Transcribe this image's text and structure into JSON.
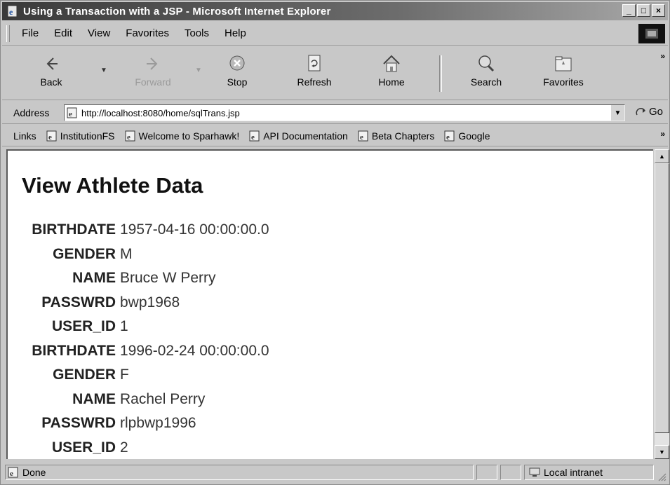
{
  "window": {
    "title": "Using a Transaction with a JSP - Microsoft Internet Explorer",
    "minimize": "_",
    "maximize": "□",
    "close": "×"
  },
  "menu": [
    "File",
    "Edit",
    "View",
    "Favorites",
    "Tools",
    "Help"
  ],
  "toolbar": {
    "back": "Back",
    "forward": "Forward",
    "stop": "Stop",
    "refresh": "Refresh",
    "home": "Home",
    "search": "Search",
    "favorites": "Favorites",
    "more": "»"
  },
  "address": {
    "label": "Address",
    "url": "http://localhost:8080/home/sqlTrans.jsp",
    "go": "Go"
  },
  "links": {
    "label": "Links",
    "items": [
      "InstitutionFS",
      "Welcome to Sparhawk!",
      "API Documentation",
      "Beta Chapters",
      "Google"
    ],
    "more": "»"
  },
  "page": {
    "heading": "View Athlete Data",
    "rows": [
      {
        "name": "BIRTHDATE",
        "value": "1957-04-16 00:00:00.0"
      },
      {
        "name": "GENDER",
        "value": "M"
      },
      {
        "name": "NAME",
        "value": "Bruce W Perry"
      },
      {
        "name": "PASSWRD",
        "value": "bwp1968"
      },
      {
        "name": "USER_ID",
        "value": "1"
      },
      {
        "name": "BIRTHDATE",
        "value": "1996-02-24 00:00:00.0"
      },
      {
        "name": "GENDER",
        "value": "F"
      },
      {
        "name": "NAME",
        "value": "Rachel Perry"
      },
      {
        "name": "PASSWRD",
        "value": "rlpbwp1996"
      },
      {
        "name": "USER_ID",
        "value": "2"
      }
    ]
  },
  "status": {
    "text": "Done",
    "zone": "Local intranet"
  },
  "colors": {
    "chrome": "#c8c8c8",
    "titlebar": "#3a3a3a",
    "content_bg": "#ffffff"
  },
  "icons": [
    "ie-page-icon",
    "back-arrow-icon",
    "forward-arrow-icon",
    "stop-icon",
    "refresh-icon",
    "home-icon",
    "search-icon",
    "favorites-icon",
    "go-arrow-icon",
    "intranet-zone-icon"
  ]
}
